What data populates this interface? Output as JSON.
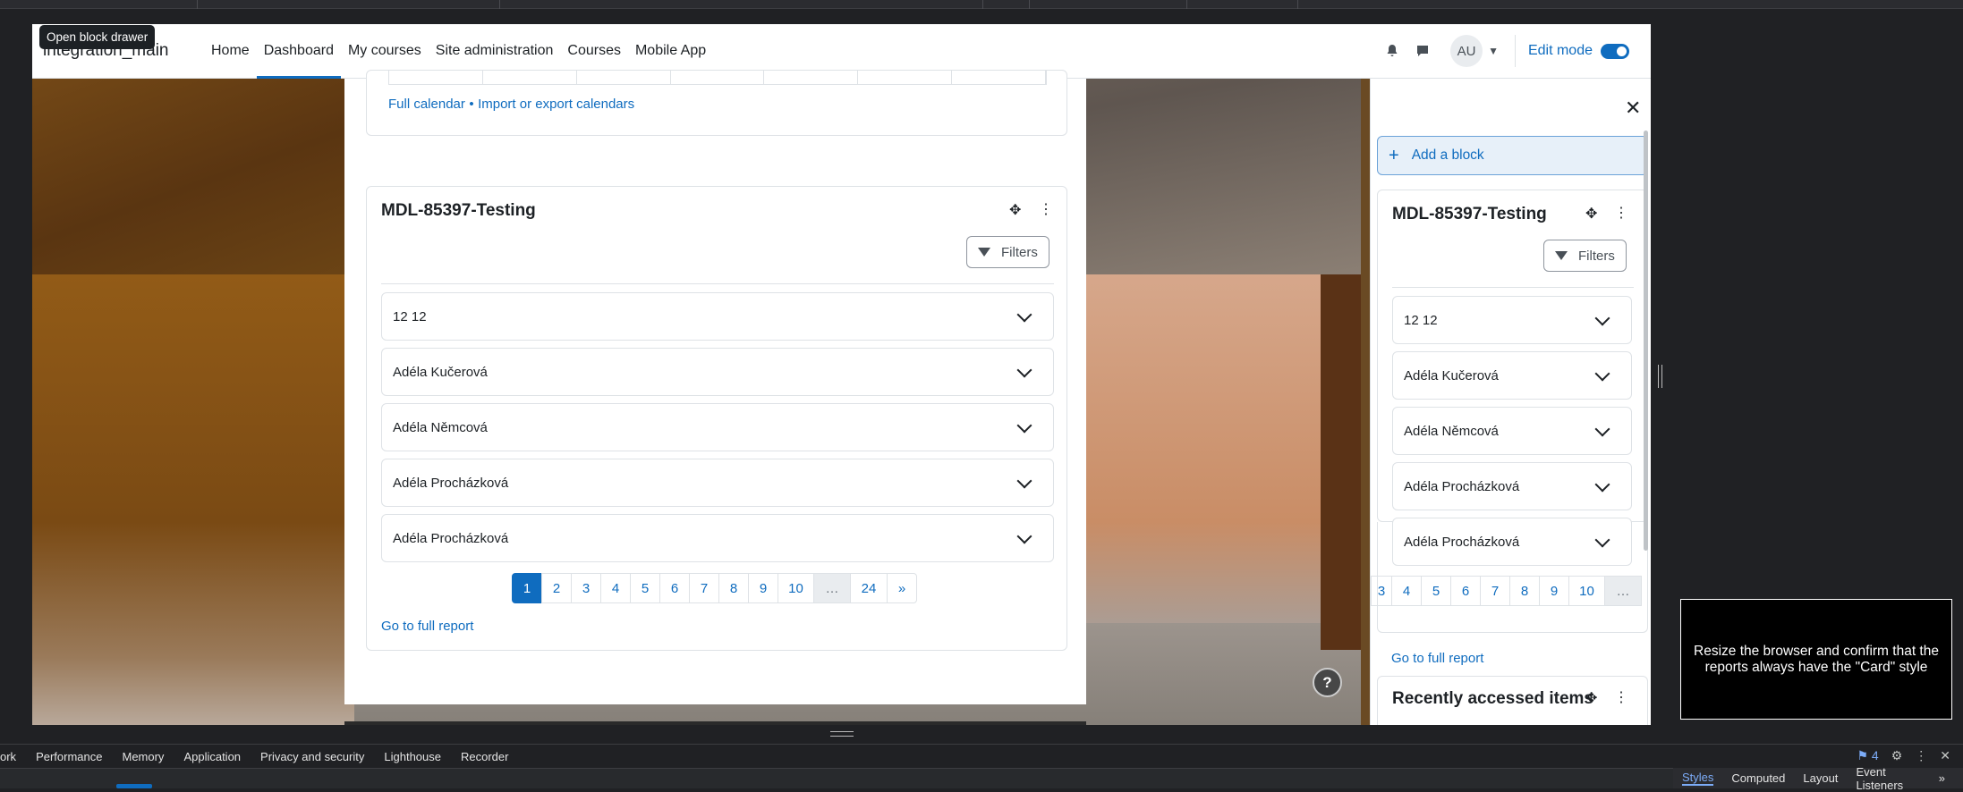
{
  "tooltip": "Open block drawer",
  "navbar": {
    "brand": "integration_main",
    "links": [
      "Home",
      "Dashboard",
      "My courses",
      "Site administration",
      "Courses",
      "Mobile App"
    ],
    "avatar": "AU",
    "edit_mode": "Edit mode"
  },
  "calendar": {
    "full_calendar": "Full calendar",
    "separator": "•",
    "import_export": "Import or export calendars"
  },
  "report": {
    "title": "MDL-85397-Testing",
    "filters": "Filters",
    "items": [
      "12 12",
      "Adéla Kučerová",
      "Adéla Němcová",
      "Adéla Procházková",
      "Adéla Procházková"
    ],
    "pages": [
      "1",
      "2",
      "3",
      "4",
      "5",
      "6",
      "7",
      "8",
      "9",
      "10",
      "…",
      "24",
      "»"
    ],
    "full_report": "Go to full report"
  },
  "drawer": {
    "add_block": "Add a block",
    "report_title": "MDL-85397-Testing",
    "filters": "Filters",
    "items": [
      "12 12",
      "Adéla Kučerová",
      "Adéla Němcová",
      "Adéla Procházková",
      "Adéla Procházková"
    ],
    "pages": [
      "3",
      "4",
      "5",
      "6",
      "7",
      "8",
      "9",
      "10",
      "…"
    ],
    "full_report": "Go to full report",
    "recent_title": "Recently accessed items"
  },
  "help": "?",
  "note": "Resize the browser and confirm that the reports always have the \"Card\" style",
  "devtools": {
    "tabs": [
      "ork",
      "Performance",
      "Memory",
      "Application",
      "Privacy and security",
      "Lighthouse",
      "Recorder"
    ],
    "issues_count": "4",
    "side_tabs": [
      "Styles",
      "Computed",
      "Layout",
      "Event Listeners",
      "»"
    ]
  },
  "colors": {
    "primary": "#0f6cbf",
    "text": "#1d2125",
    "border": "#dee2e6"
  }
}
